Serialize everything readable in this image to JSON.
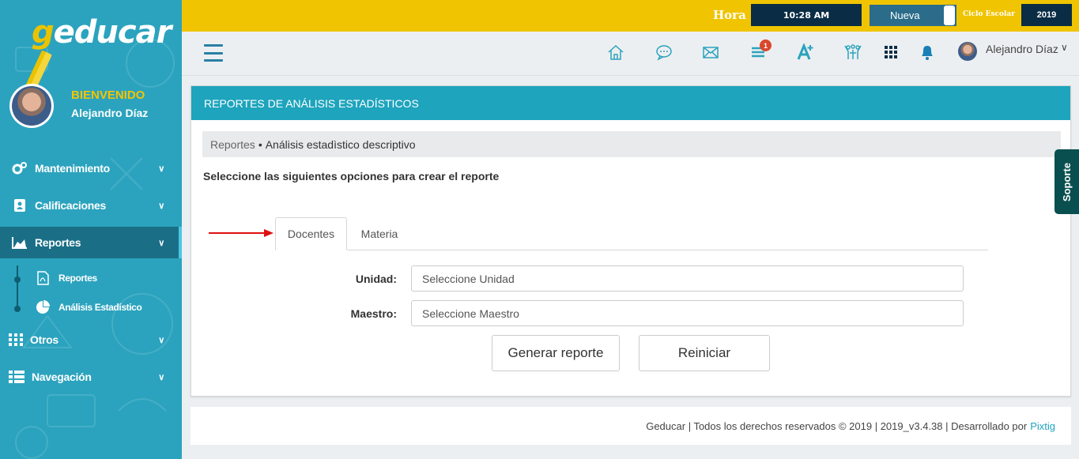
{
  "sidebar": {
    "logo_text_1": "g",
    "logo_text_2": "educar",
    "welcome": "BIENVENIDO",
    "user_name": "Alejandro Díaz",
    "items": [
      {
        "label": "Mantenimiento",
        "icon": "gears-icon"
      },
      {
        "label": "Calificaciones",
        "icon": "contact-book-icon"
      },
      {
        "label": "Reportes",
        "icon": "area-chart-icon"
      },
      {
        "label": "Otros",
        "icon": "grid-dots-icon"
      },
      {
        "label": "Navegación",
        "icon": "list-icon"
      }
    ],
    "sub_items": [
      {
        "label": "Reportes",
        "icon": "pdf-file-icon"
      },
      {
        "label": "Análisis Estadístico",
        "icon": "pie-chart-icon"
      }
    ]
  },
  "topbar": {
    "hora_label": "Hora",
    "time": "10:28 AM",
    "nueva_label": "Nueva",
    "ciclo_label": "Ciclo Escolar",
    "ciclo_value": "2019"
  },
  "header": {
    "notification_badge": "1",
    "user_name": "Alejandro Díaz"
  },
  "panel": {
    "title": "REPORTES DE ANÁLISIS ESTADÍSTICOS",
    "breadcrumb_link": "Reportes",
    "breadcrumb_sep": "•",
    "breadcrumb_current": "Análisis estadìstico descriptivo",
    "instructions": "Seleccione las siguientes opciones para crear el reporte",
    "tabs": [
      "Docentes",
      "Materia"
    ],
    "fields": [
      {
        "label": "Unidad:",
        "placeholder": "Seleccione Unidad"
      },
      {
        "label": "Maestro:",
        "placeholder": "Seleccione Maestro"
      }
    ],
    "generate_button": "Generar reporte",
    "reset_button": "Reiniciar"
  },
  "support_tab": "Soporte",
  "footer": {
    "text": "Geducar | Todos los derechos reservados © 2019 | 2019_v3.4.38 | Desarrollado por",
    "link": "Pixtig"
  },
  "colors": {
    "sidebar_bg": "#2ba3be",
    "topbar_bg": "#f0c400",
    "panel_header": "#1ea4bd",
    "accent_dark": "#0a2d45",
    "arrow": "#e01010"
  }
}
